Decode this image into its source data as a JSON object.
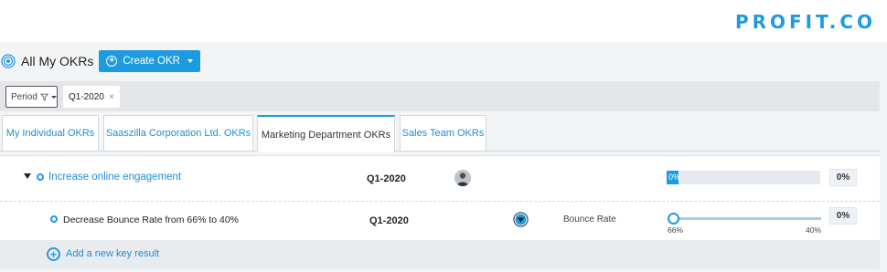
{
  "brand": {
    "logo_text": "PROFIT.CO",
    "color": "#1e9be0"
  },
  "header": {
    "title": "All My OKRs",
    "create_button": "Create OKR"
  },
  "filters": {
    "period_label": "Period",
    "chip_value": "Q1-2020",
    "chip_remove": "×"
  },
  "tabs": [
    {
      "label": "My Individual OKRs",
      "active": false
    },
    {
      "label": "Saaszilla Corporation Ltd. OKRs",
      "active": false
    },
    {
      "label": "Marketing Department OKRs",
      "active": true
    },
    {
      "label": "Sales Team OKRs",
      "active": false
    }
  ],
  "objective": {
    "title": "Increase online engagement",
    "period": "Q1-2020",
    "progress": 0,
    "progress_label": "0%",
    "score": "0%"
  },
  "key_result": {
    "title": "Decrease Bounce Rate from 66% to 40%",
    "period": "Q1-2020",
    "metric": "Bounce Rate",
    "start_label": "66%",
    "target_label": "40%",
    "current_progress": 0,
    "score": "0%"
  },
  "add_key_result_label": "Add a new key result",
  "colors": {
    "accent": "#1e9be0",
    "link": "#1e8ed3"
  }
}
